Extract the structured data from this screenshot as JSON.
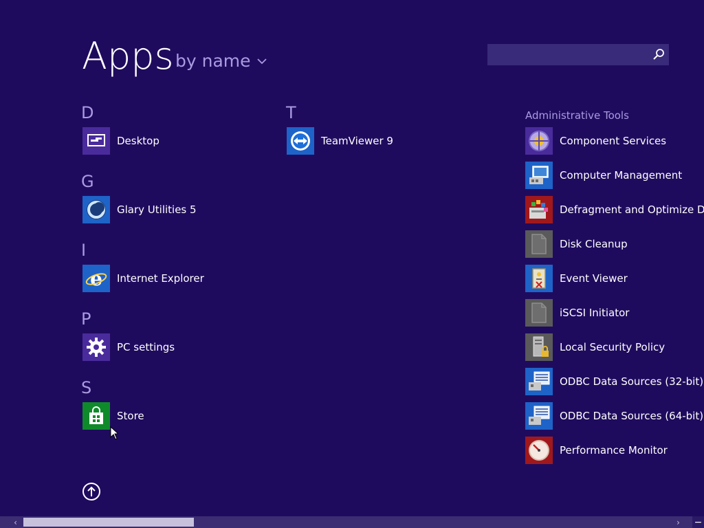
{
  "header": {
    "title": "Apps",
    "sort_label": "by name"
  },
  "search": {
    "placeholder": ""
  },
  "colors": {
    "background": "#1f0b5e",
    "accent_text": "#a99be0",
    "tile_purple": "#4a2b9c",
    "tile_blue": "#1e63c8",
    "tile_green": "#0f8a2a",
    "tile_gray": "#5a5a5a",
    "tile_red": "#a1181c"
  },
  "groups": {
    "d": {
      "letter": "D",
      "items": [
        {
          "label": "Desktop",
          "icon": "desktop-icon"
        }
      ]
    },
    "g": {
      "letter": "G",
      "items": [
        {
          "label": "Glary Utilities 5",
          "icon": "glary-utilities-icon"
        }
      ]
    },
    "i": {
      "letter": "I",
      "items": [
        {
          "label": "Internet Explorer",
          "icon": "internet-explorer-icon"
        }
      ]
    },
    "p": {
      "letter": "P",
      "items": [
        {
          "label": "PC settings",
          "icon": "gear-icon"
        }
      ]
    },
    "s": {
      "letter": "S",
      "items": [
        {
          "label": "Store",
          "icon": "store-bag-icon"
        }
      ]
    },
    "t": {
      "letter": "T",
      "items": [
        {
          "label": "TeamViewer 9",
          "icon": "teamviewer-icon"
        }
      ]
    },
    "admin": {
      "title": "Administrative Tools",
      "items": [
        {
          "label": "Component Services",
          "icon": "component-services-icon"
        },
        {
          "label": "Computer Management",
          "icon": "computer-management-icon"
        },
        {
          "label": "Defragment and Optimize Drives",
          "icon": "defragment-icon"
        },
        {
          "label": "Disk Cleanup",
          "icon": "document-icon"
        },
        {
          "label": "Event Viewer",
          "icon": "event-viewer-icon"
        },
        {
          "label": "iSCSI Initiator",
          "icon": "document-icon"
        },
        {
          "label": "Local Security Policy",
          "icon": "security-policy-icon"
        },
        {
          "label": "ODBC Data Sources (32-bit)",
          "icon": "odbc-icon"
        },
        {
          "label": "ODBC Data Sources (64-bit)",
          "icon": "odbc-icon"
        },
        {
          "label": "Performance Monitor",
          "icon": "performance-monitor-icon"
        }
      ]
    }
  },
  "scroll": {
    "position_fraction": 0.03,
    "visible_fraction": 0.24
  }
}
